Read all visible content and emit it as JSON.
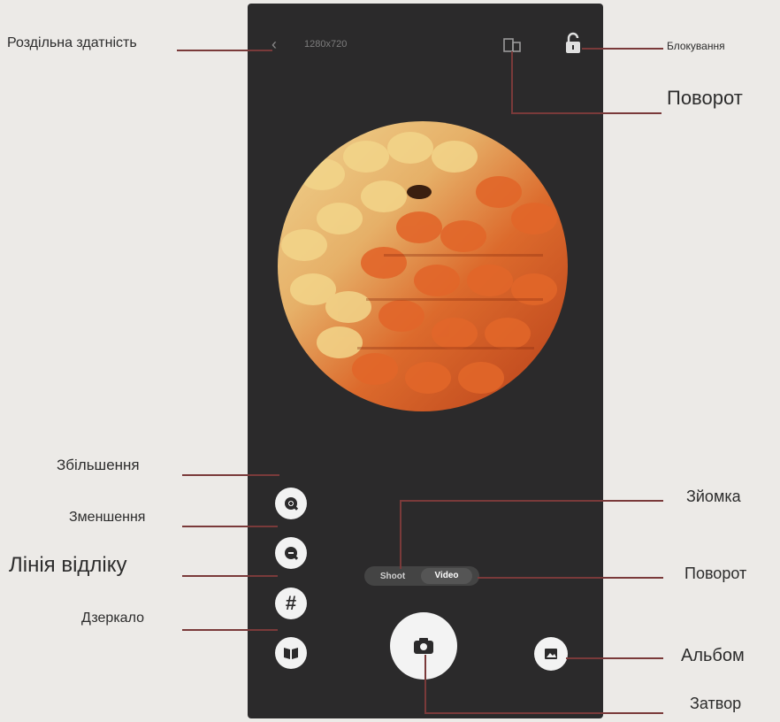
{
  "screen": {
    "back_icon": "chevron-left-icon",
    "resolution": "1280x720",
    "rotate_icon": "rotate-icon",
    "lock_icon": "lock-icon"
  },
  "sidebar": {
    "zoom_in_icon": "zoom-in-icon",
    "zoom_out_icon": "zoom-out-icon",
    "grid_icon": "grid-icon",
    "mirror_icon": "mirror-icon"
  },
  "mode": {
    "shot": "Shoot",
    "video": "Video"
  },
  "controls": {
    "shutter_icon": "camera-icon",
    "album_icon": "album-icon"
  },
  "annotations": {
    "resolution": "Роздільна здатність",
    "lock": "Блокування",
    "rotate_top": "Поворот",
    "zoom_in": "Збільшення",
    "zoom_out": "Зменшення",
    "grid": "Лінія відліку",
    "mirror": "Дзеркало",
    "capture": "Зйомка",
    "rotate_mode": "Поворот",
    "album": "Альбом",
    "shutter": "Затвор"
  },
  "colors": {
    "accent_line": "#7a3a3a",
    "phone_bg": "#2b2a2b",
    "specimen_light": "#e8c070",
    "specimen_dark": "#d0501e"
  }
}
